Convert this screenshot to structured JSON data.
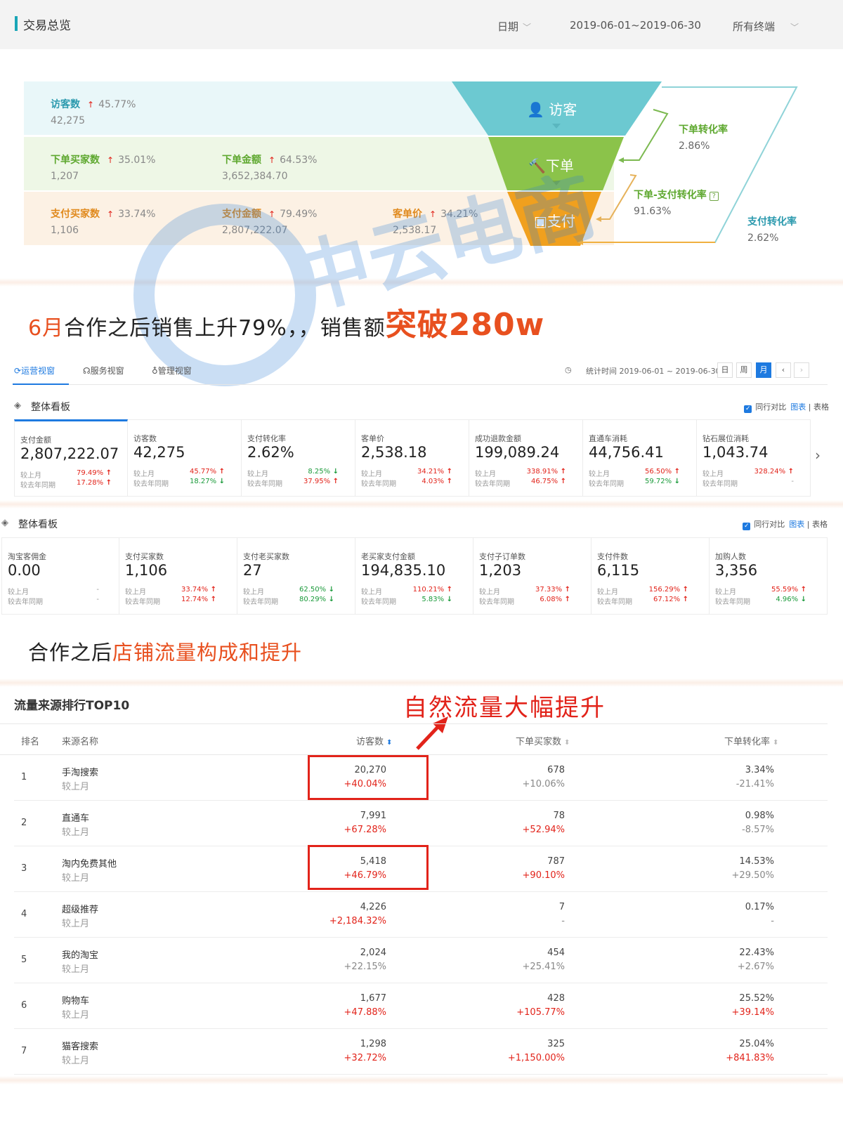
{
  "overview": {
    "title": "交易总览",
    "date_label": "日期",
    "date_range": "2019-06-01~2019-06-30",
    "terminal": "所有终端"
  },
  "funnel": {
    "visitors": {
      "label": "访客数",
      "pct": "45.77%",
      "value": "42,275"
    },
    "order_buyers": {
      "label": "下单买家数",
      "pct": "35.01%",
      "value": "1,207"
    },
    "order_amount": {
      "label": "下单金额",
      "pct": "64.53%",
      "value": "3,652,384.70"
    },
    "pay_buyers": {
      "label": "支付买家数",
      "pct": "33.74%",
      "value": "1,106"
    },
    "pay_amount": {
      "label": "支付金额",
      "pct": "79.49%",
      "value": "2,807,222.07"
    },
    "unit_price": {
      "label": "客单价",
      "pct": "34.21%",
      "value": "2,538.17"
    },
    "stage_visit": "访客",
    "stage_order": "下单",
    "stage_pay": "支付",
    "rate_order": {
      "label": "下单转化率",
      "value": "2.86%"
    },
    "rate_order_pay": {
      "label": "下单-支付转化率",
      "value": "91.63%"
    },
    "rate_pay": {
      "label": "支付转化率",
      "value": "2.62%"
    },
    "colors": {
      "visit": "#6cc9d1",
      "order": "#8bc34a",
      "pay": "#f0a01e"
    }
  },
  "headline1": {
    "a": "6月",
    "b": "合作之后销售上升79%，，销售额",
    "c": "突破280w"
  },
  "watermark": "中云电商",
  "dash": {
    "tabs": [
      "运营视窗",
      "服务视窗",
      "管理视窗"
    ],
    "stat_time": "统计时间 2019-06-01 ~ 2019-06-30",
    "periods": [
      "日",
      "周",
      "月"
    ],
    "board1_title": "整体看板",
    "board2_title": "整体看板",
    "compare": "同行对比",
    "chart": "图表",
    "table": "表格",
    "row_labels": [
      "较上月",
      "较去年同期"
    ],
    "cards1": [
      {
        "label": "支付金额",
        "value": "2,807,222.07",
        "p1": "79.49%",
        "d1": "up",
        "p2": "17.28%",
        "d2": "up"
      },
      {
        "label": "访客数",
        "value": "42,275",
        "p1": "45.77%",
        "d1": "up",
        "p2": "18.27%",
        "d2": "dn"
      },
      {
        "label": "支付转化率",
        "value": "2.62%",
        "p1": "8.25%",
        "d1": "dn",
        "p2": "37.95%",
        "d2": "up"
      },
      {
        "label": "客单价",
        "value": "2,538.18",
        "p1": "34.21%",
        "d1": "up",
        "p2": "4.03%",
        "d2": "up"
      },
      {
        "label": "成功退款金额",
        "value": "199,089.24",
        "p1": "338.91%",
        "d1": "up",
        "p2": "46.75%",
        "d2": "up"
      },
      {
        "label": "直通车消耗",
        "value": "44,756.41",
        "p1": "56.50%",
        "d1": "up",
        "p2": "59.72%",
        "d2": "dn"
      },
      {
        "label": "钻石展位消耗",
        "value": "1,043.74",
        "p1": "328.24%",
        "d1": "up",
        "p2": "-",
        "d2": ""
      }
    ],
    "cards2": [
      {
        "label": "淘宝客佣金",
        "value": "0.00",
        "p1": "-",
        "d1": "",
        "p2": "-",
        "d2": ""
      },
      {
        "label": "支付买家数",
        "value": "1,106",
        "p1": "33.74%",
        "d1": "up",
        "p2": "12.74%",
        "d2": "up"
      },
      {
        "label": "支付老买家数",
        "value": "27",
        "p1": "62.50%",
        "d1": "dn",
        "p2": "80.29%",
        "d2": "dn"
      },
      {
        "label": "老买家支付金额",
        "value": "194,835.10",
        "p1": "110.21%",
        "d1": "up",
        "p2": "5.83%",
        "d2": "dn"
      },
      {
        "label": "支付子订单数",
        "value": "1,203",
        "p1": "37.33%",
        "d1": "up",
        "p2": "6.08%",
        "d2": "up"
      },
      {
        "label": "支付件数",
        "value": "6,115",
        "p1": "156.29%",
        "d1": "up",
        "p2": "67.12%",
        "d2": "up"
      },
      {
        "label": "加购人数",
        "value": "3,356",
        "p1": "55.59%",
        "d1": "up",
        "p2": "4.96%",
        "d2": "dn"
      }
    ]
  },
  "headline2": {
    "a": "合作之后",
    "b": "店铺流量构成和提升"
  },
  "traffic": {
    "title": "流量来源排行TOP10",
    "annotation": "自然流量大幅提升",
    "headers": [
      "排名",
      "来源名称",
      "访客数",
      "下单买家数",
      "下单转化率"
    ],
    "sub_label": "较上月",
    "rows": [
      {
        "rank": "1",
        "name": "手淘搜索",
        "v": "20,270",
        "vc": "+40.04%",
        "vr": true,
        "b": "678",
        "bc": "+10.06%",
        "br": false,
        "c": "3.34%",
        "cc": "-21.41%",
        "cr": false
      },
      {
        "rank": "2",
        "name": "直通车",
        "v": "7,991",
        "vc": "+67.28%",
        "vr": true,
        "b": "78",
        "bc": "+52.94%",
        "br": true,
        "c": "0.98%",
        "cc": "-8.57%",
        "cr": false
      },
      {
        "rank": "3",
        "name": "淘内免费其他",
        "v": "5,418",
        "vc": "+46.79%",
        "vr": true,
        "b": "787",
        "bc": "+90.10%",
        "br": true,
        "c": "14.53%",
        "cc": "+29.50%",
        "cr": false
      },
      {
        "rank": "4",
        "name": "超级推荐",
        "v": "4,226",
        "vc": "+2,184.32%",
        "vr": true,
        "b": "7",
        "bc": "-",
        "br": false,
        "c": "0.17%",
        "cc": "-",
        "cr": false
      },
      {
        "rank": "5",
        "name": "我的淘宝",
        "v": "2,024",
        "vc": "+22.15%",
        "vr": false,
        "b": "454",
        "bc": "+25.41%",
        "br": false,
        "c": "22.43%",
        "cc": "+2.67%",
        "cr": false
      },
      {
        "rank": "6",
        "name": "购物车",
        "v": "1,677",
        "vc": "+47.88%",
        "vr": true,
        "b": "428",
        "bc": "+105.77%",
        "br": true,
        "c": "25.52%",
        "cc": "+39.14%",
        "cr": true
      },
      {
        "rank": "7",
        "name": "猫客搜索",
        "v": "1,298",
        "vc": "+32.72%",
        "vr": true,
        "b": "325",
        "bc": "+1,150.00%",
        "br": true,
        "c": "25.04%",
        "cc": "+841.83%",
        "cr": true
      }
    ]
  }
}
